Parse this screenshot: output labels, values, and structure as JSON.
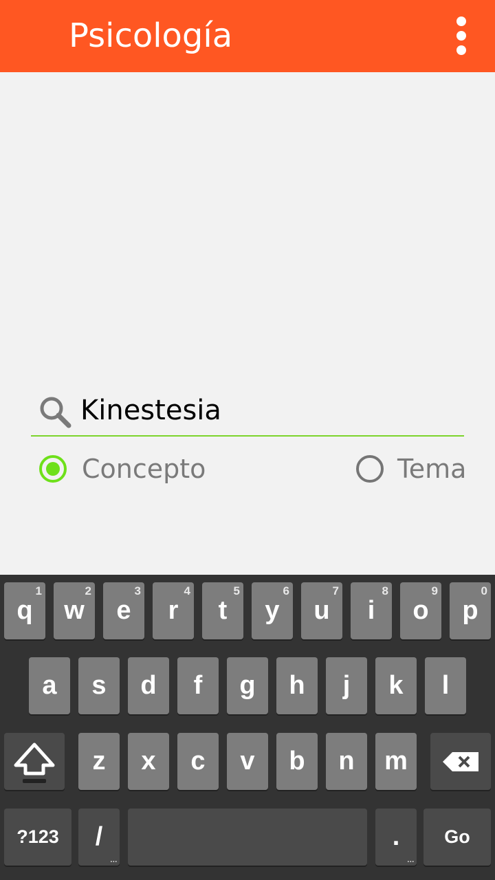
{
  "app": {
    "title": "Psicología",
    "accent_color": "#ff5722",
    "overflow_icon": "more-vert-icon"
  },
  "search": {
    "icon": "search-icon",
    "value": "Kinestesia",
    "underline_color": "#7cd42b"
  },
  "options": [
    {
      "label": "Concepto",
      "checked": true
    },
    {
      "label": "Tema",
      "checked": false
    }
  ],
  "keyboard": {
    "row1": [
      {
        "key": "q",
        "hint": "1"
      },
      {
        "key": "w",
        "hint": "2"
      },
      {
        "key": "e",
        "hint": "3"
      },
      {
        "key": "r",
        "hint": "4"
      },
      {
        "key": "t",
        "hint": "5"
      },
      {
        "key": "y",
        "hint": "6"
      },
      {
        "key": "u",
        "hint": "7"
      },
      {
        "key": "i",
        "hint": "8"
      },
      {
        "key": "o",
        "hint": "9"
      },
      {
        "key": "p",
        "hint": "0"
      }
    ],
    "row2": [
      "a",
      "s",
      "d",
      "f",
      "g",
      "h",
      "j",
      "k",
      "l"
    ],
    "row3": [
      "z",
      "x",
      "c",
      "v",
      "b",
      "n",
      "m"
    ],
    "shift_icon": "shift-icon",
    "backspace_icon": "backspace-icon",
    "symbols_label": "?123",
    "slash_label": "/",
    "slash_more": "...",
    "period_label": ".",
    "period_more": "...",
    "go_label": "Go"
  }
}
